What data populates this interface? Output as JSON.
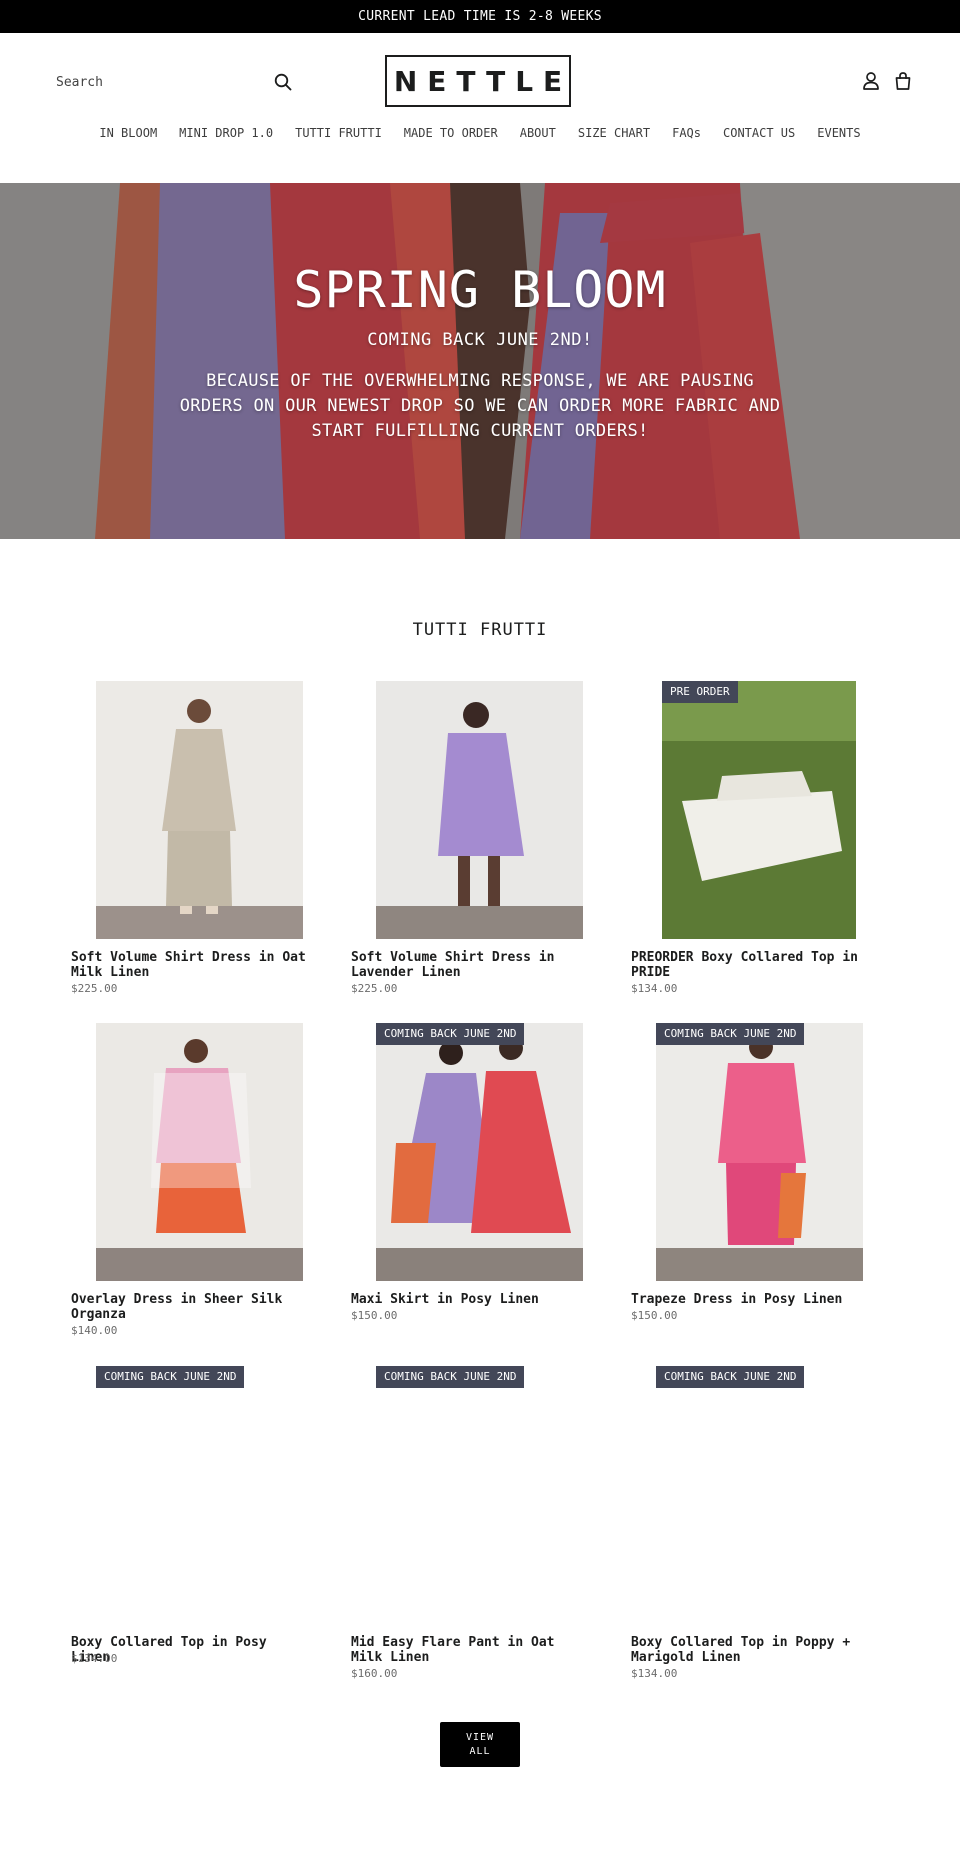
{
  "announcement": "CURRENT LEAD TIME IS 2-8 WEEKS",
  "header": {
    "search_placeholder": "Search",
    "logo": "NETTLE"
  },
  "nav": [
    "IN BLOOM",
    "MINI DROP 1.0",
    "TUTTI FRUTTI",
    "MADE TO ORDER",
    "ABOUT",
    "SIZE CHART",
    "FAQs",
    "CONTACT US",
    "EVENTS"
  ],
  "hero": {
    "title": "SPRING BLOOM",
    "subtitle": "COMING BACK JUNE 2ND!",
    "body": "BECAUSE OF THE OVERWHELMING RESPONSE, WE ARE PAUSING ORDERS ON OUR NEWEST DROP SO WE CAN ORDER MORE FABRIC AND START FULFILLING CURRENT ORDERS!"
  },
  "collection": {
    "title": "TUTTI FRUTTI",
    "view_all": "VIEW\nALL",
    "products": [
      {
        "title": "Soft Volume Shirt Dress in Oat Milk Linen",
        "price": "$225.00",
        "badge": ""
      },
      {
        "title": "Soft Volume Shirt Dress in Lavender Linen",
        "price": "$225.00",
        "badge": ""
      },
      {
        "title": "PREORDER Boxy Collared Top in PRIDE",
        "price": "$134.00",
        "badge": "PRE ORDER"
      },
      {
        "title": "Overlay Dress in Sheer Silk Organza",
        "price": "$140.00",
        "badge": ""
      },
      {
        "title": "Maxi Skirt in Posy Linen",
        "price": "$150.00",
        "badge": "COMING BACK JUNE 2ND"
      },
      {
        "title": "Trapeze Dress in Posy Linen",
        "price": "$150.00",
        "badge": "COMING BACK JUNE 2ND"
      },
      {
        "title": "Boxy Collared Top in Posy Linen",
        "price": "$134.00",
        "badge": "COMING BACK JUNE 2ND"
      },
      {
        "title": "Mid Easy Flare Pant in Oat Milk Linen",
        "price": "$160.00",
        "badge": "COMING BACK JUNE 2ND"
      },
      {
        "title": "Boxy Collared Top in Poppy + Marigold Linen",
        "price": "$134.00",
        "badge": "COMING BACK JUNE 2ND"
      }
    ]
  },
  "colors": {
    "badge_bg": "#434758",
    "announcement_bg": "#000000",
    "button_bg": "#000000"
  }
}
